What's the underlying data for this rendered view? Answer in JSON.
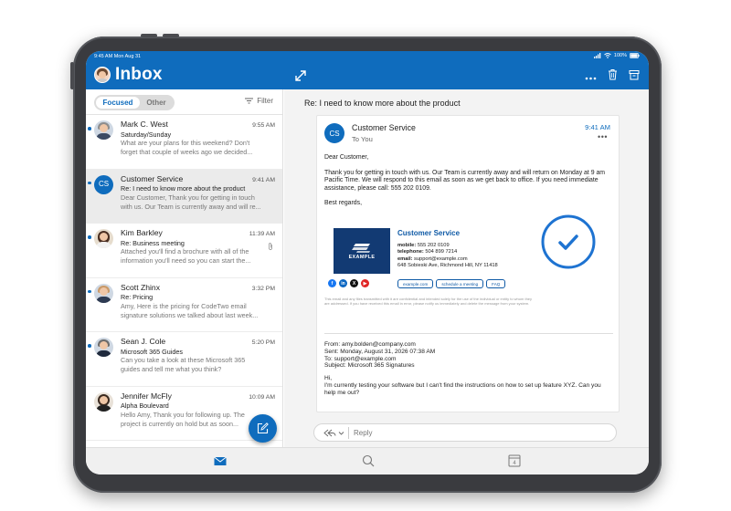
{
  "statusbar": {
    "time": "9:45 AM Mon Aug 31",
    "battery": "100%"
  },
  "appbar": {
    "title": "Inbox"
  },
  "filter": {
    "focused_label": "Focused",
    "other_label": "Other",
    "filter_label": "Filter"
  },
  "messages": [
    {
      "sender": "Mark C. West",
      "time": "9:55 AM",
      "subject": "Saturday/Sunday",
      "preview1": "What are your plans for this weekend? Don't",
      "preview2": "forget that couple of weeks ago we decided..."
    },
    {
      "sender": "Customer Service",
      "initials": "CS",
      "time": "9:41 AM",
      "subject": "Re: I need to know more about the product",
      "preview1": "Dear Customer, Thank you for getting in touch",
      "preview2": "with us. Our Team is currently away and will re..."
    },
    {
      "sender": "Kim Barkley",
      "time": "11:39 AM",
      "subject": "Re: Business meeting",
      "preview1": "Attached you'll find a brochure with all of the",
      "preview2": "information you'll need so you can start the..."
    },
    {
      "sender": "Scott Zhinx",
      "time": "3:32 PM",
      "subject": "Re: Pricing",
      "preview1": "Amy, Here is the pricing for CodeTwo email",
      "preview2": "signature solutions we talked about last week..."
    },
    {
      "sender": "Sean J. Cole",
      "time": "5:20 PM",
      "subject": "Microsoft 365 Guides",
      "preview1": "Can you take a look at these Microsoft 365",
      "preview2": "guides and tell me what you think?"
    },
    {
      "sender": "Jennifer McFly",
      "time": "10:09 AM",
      "subject": "Alpha Boulevard",
      "preview1": "Hello Amy, Thank you for following up. The",
      "preview2": "project is currently on hold but as soon..."
    }
  ],
  "reading": {
    "subject": "Re: I need to know more about the product",
    "initials": "CS",
    "from": "Customer Service",
    "to": "To You",
    "time": "9:41 AM",
    "greeting": "Dear Customer,",
    "body": "Thank you for getting in touch with us. Our Team is currently away and will return on Monday at 9 am Pacific Time. We will respond to this email as soon as we get back to office. If you need immediate assistance, please call: 555 202 0109.",
    "closing": "Best regards,",
    "signature": {
      "logo_text": "EXAMPLE",
      "name": "Customer Service",
      "mobile_label": "mobile:",
      "mobile": "555 202 0109",
      "telephone_label": "telephone:",
      "telephone": "504 899 7214",
      "email_label": "email:",
      "email": "support@example.com",
      "address": "648 Sobieski Ave, Richmond Hill, NY 11418",
      "btn1": "example.com",
      "btn2": "schedule a meeting",
      "btn3": "FAQ",
      "disclaimer": "This email and any files transmitted with it are confidential and intended solely for the use of the individual or entity to whom they are addressed. If you have received this email in error, please notify us immediately and delete the message from your system."
    },
    "quoted": {
      "from": "From: amy.bolden@company.com",
      "sent": "Sent: Monday, August 31, 2026 07:38 AM",
      "to": "To: support@example.com",
      "subject": "Subject: Microsoft 365 Signatures",
      "hi": "Hi,",
      "body": "I'm currently testing your software but I can't find the instructions on how to set up feature XYZ. Can you help me out?"
    },
    "reply_placeholder": "Reply"
  },
  "tabbar": {
    "calendar_day": "4"
  },
  "colors": {
    "accent": "#0f6cbd",
    "signature_navy": "#123a73"
  }
}
